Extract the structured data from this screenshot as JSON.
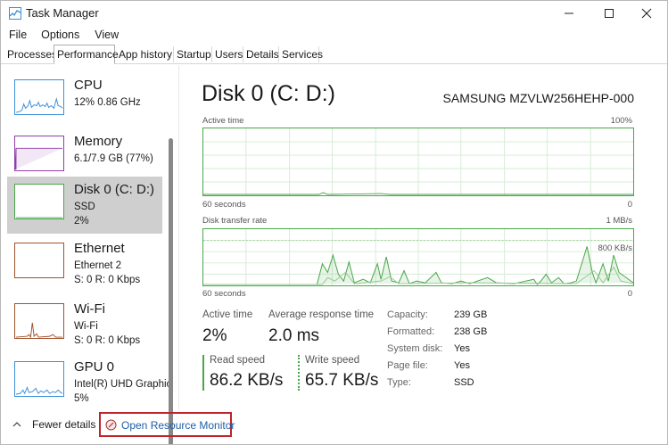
{
  "window": {
    "title": "Task Manager"
  },
  "menu": [
    "File",
    "Options",
    "View"
  ],
  "tabs": [
    "Processes",
    "Performance",
    "App history",
    "Startup",
    "Users",
    "Details",
    "Services"
  ],
  "resources": [
    {
      "name": "CPU",
      "line1": "12%  0.86 GHz",
      "line2": ""
    },
    {
      "name": "Memory",
      "line1": "6.1/7.9 GB (77%)",
      "line2": ""
    },
    {
      "name": "Disk 0 (C: D:)",
      "line1": "SSD",
      "line2": "2%"
    },
    {
      "name": "Ethernet",
      "line1": "Ethernet 2",
      "line2": "S: 0  R: 0 Kbps"
    },
    {
      "name": "Wi-Fi",
      "line1": "Wi-Fi",
      "line2": "S: 0  R: 0 Kbps"
    },
    {
      "name": "GPU 0",
      "line1": "Intel(R) UHD Graphic",
      "line2": "5%"
    }
  ],
  "detail": {
    "heading": "Disk 0 (C: D:)",
    "model": "SAMSUNG MZVLW256HEHP-000",
    "graph1": {
      "label": "Active time",
      "max": "100%",
      "time": "60 seconds",
      "min": "0"
    },
    "graph2": {
      "label": "Disk transfer rate",
      "max": "1 MB/s",
      "mark": "800 KB/s",
      "time": "60 seconds",
      "min": "0"
    },
    "stats": {
      "active_time_label": "Active time",
      "active_time": "2%",
      "avg_resp_label": "Average response time",
      "avg_resp": "2.0 ms",
      "read_label": "Read speed",
      "read": "86.2 KB/s",
      "write_label": "Write speed",
      "write": "65.7 KB/s"
    },
    "props": [
      {
        "label": "Capacity:",
        "value": "239 GB"
      },
      {
        "label": "Formatted:",
        "value": "238 GB"
      },
      {
        "label": "System disk:",
        "value": "Yes"
      },
      {
        "label": "Page file:",
        "value": "Yes"
      },
      {
        "label": "Type:",
        "value": "SSD"
      }
    ]
  },
  "bottom": {
    "fewer": "Fewer details",
    "resource_monitor": "Open Resource Monitor"
  },
  "colors": {
    "cpu": "#3c8ed8",
    "memory": "#8e3fa8",
    "disk": "#4aa64a",
    "network": "#a0522d",
    "gpu": "#3c8ed8",
    "highlight": "#c0232b"
  }
}
